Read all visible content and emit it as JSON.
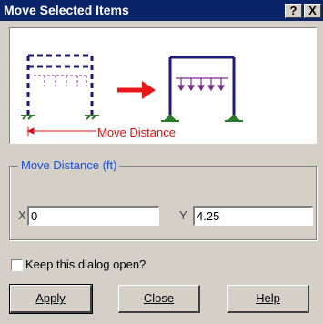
{
  "window": {
    "title": "Move Selected Items",
    "help_glyph": "?",
    "close_glyph": "X"
  },
  "diagram": {
    "move_label": "Move Distance",
    "colors": {
      "frame": "#1e1a78",
      "load": "#7a2a8a",
      "arrow": "#e81818",
      "support": "#2a7a2a"
    }
  },
  "group": {
    "legend": "Move Distance (ft)",
    "x_label": "X",
    "x_value": "0",
    "y_label": "Y",
    "y_value": "4.25"
  },
  "keep_open": {
    "label": "Keep this dialog open?",
    "checked": false
  },
  "buttons": {
    "apply": "Apply",
    "close": "Close",
    "help": "Help"
  }
}
